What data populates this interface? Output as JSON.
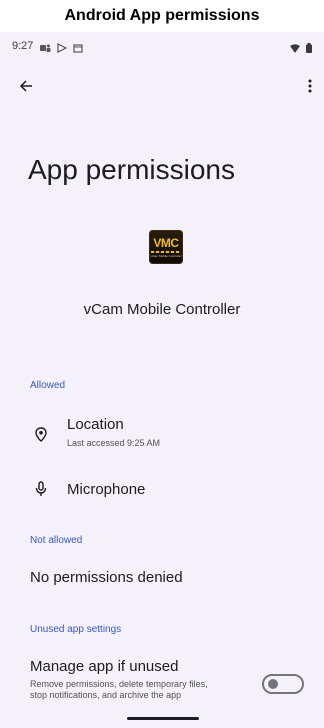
{
  "caption": "Android App permissions",
  "status_bar": {
    "time": "9:27"
  },
  "toolbar": {
    "back_icon": "arrow-left-icon",
    "overflow_icon": "more-vert-icon"
  },
  "page": {
    "title": "App permissions"
  },
  "app": {
    "name": "vCam Mobile Controller",
    "icon_text": "VMC",
    "icon_subtext": "vCam Mobile Controller"
  },
  "sections": {
    "allowed": {
      "header": "Allowed",
      "items": [
        {
          "title": "Location",
          "subtitle": "Last accessed 9:25 AM",
          "icon": "location-pin-icon"
        },
        {
          "title": "Microphone",
          "icon": "microphone-icon"
        }
      ]
    },
    "not_allowed": {
      "header": "Not allowed",
      "empty_text": "No permissions denied"
    },
    "unused": {
      "header": "Unused app settings",
      "manage_title": "Manage app if unused",
      "manage_desc_line1": "Remove permissions, delete temporary files,",
      "manage_desc_line2": "stop notifications, and archive the app",
      "toggle_on": false
    }
  },
  "colors": {
    "background": "#f5f1fb",
    "accent": "#3558c9",
    "text": "#1c1b1f"
  }
}
